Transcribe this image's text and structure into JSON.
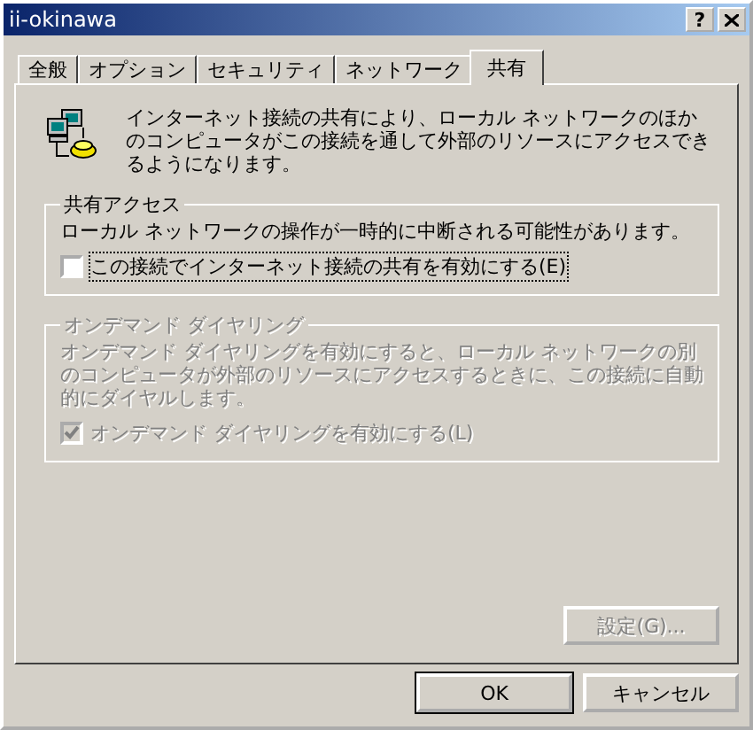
{
  "window": {
    "title": "ii-okinawa",
    "help_button": "?"
  },
  "tabs": [
    {
      "label": "全般",
      "selected": false
    },
    {
      "label": "オプション",
      "selected": false
    },
    {
      "label": "セキュリティ",
      "selected": false
    },
    {
      "label": "ネットワーク",
      "selected": false
    },
    {
      "label": "共有",
      "selected": true
    }
  ],
  "description": "インターネット接続の共有により、ローカル ネットワークのほかのコンピュータがこの接続を通して外部のリソースにアクセスできるようになります。",
  "groups": [
    {
      "title": "共有アクセス",
      "disabled": false,
      "text": "ローカル ネットワークの操作が一時的に中断される可能性があります。",
      "checkbox": {
        "label": "この接続でインターネット接続の共有を有効にする(E)",
        "checked": false,
        "focused": true
      }
    },
    {
      "title": "オンデマンド ダイヤリング",
      "disabled": true,
      "text": "オンデマンド ダイヤリングを有効にすると、ローカル ネットワークの別のコンピュータが外部のリソースにアクセスするときに、この接続に自動的にダイヤルします。",
      "checkbox": {
        "label": "オンデマンド ダイヤリングを有効にする(L)",
        "checked": true,
        "focused": false
      }
    }
  ],
  "settings_button": {
    "label": "設定(G)...",
    "disabled": true
  },
  "buttons": [
    {
      "label": "OK",
      "default": true
    },
    {
      "label": "キャンセル",
      "default": false
    }
  ]
}
